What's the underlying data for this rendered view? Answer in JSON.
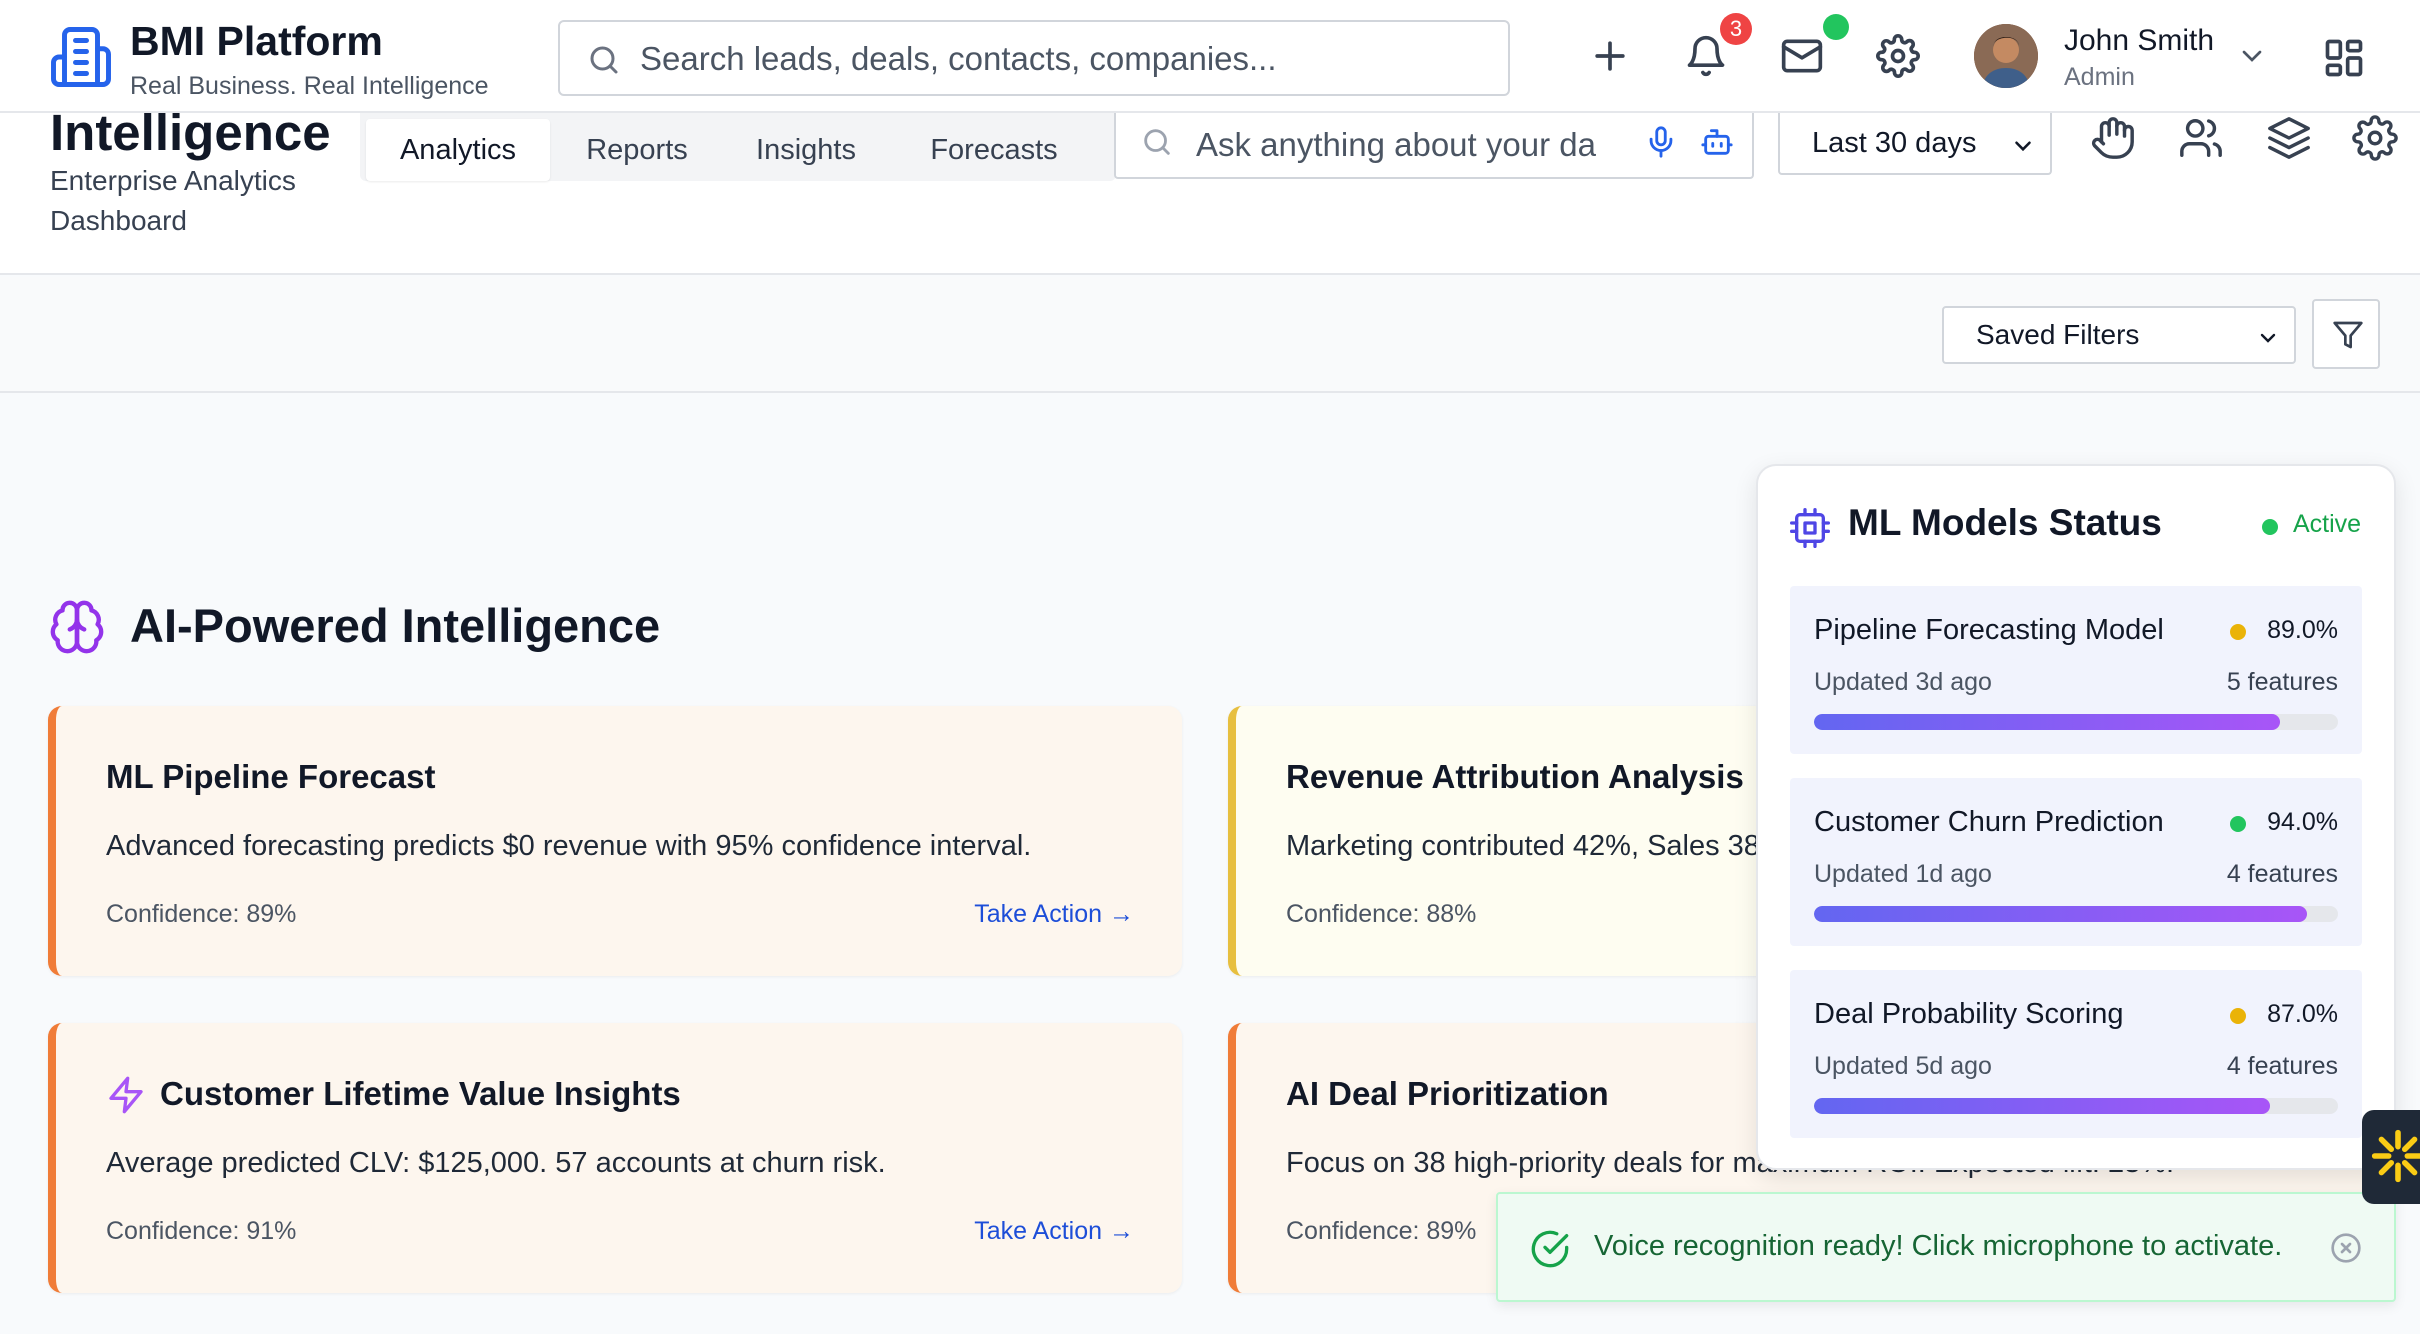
{
  "topbar": {
    "brand_name": "BMI Platform",
    "brand_tagline": "Real Business. Real Intelligence",
    "search_placeholder": "Search leads, deals, contacts, companies...",
    "notification_count": "3",
    "user_name": "John Smith",
    "user_role": "Admin"
  },
  "subheader": {
    "title": "Intelligence",
    "subtitle": "Enterprise Analytics Dashboard",
    "tabs": [
      {
        "label": "Analytics",
        "active": true
      },
      {
        "label": "Reports",
        "active": false
      },
      {
        "label": "Insights",
        "active": false
      },
      {
        "label": "Forecasts",
        "active": false
      }
    ],
    "ai_search_placeholder": "Ask anything about your da",
    "date_range": "Last 30 days"
  },
  "filterbar": {
    "saved_filters_label": "Saved Filters"
  },
  "ai_section": {
    "title": "AI-Powered Intelligence",
    "cards": [
      {
        "title": "ML Pipeline Forecast",
        "description": "Advanced forecasting predicts $0 revenue with 95% confidence interval.",
        "confidence": "Confidence: 89%",
        "action": "Take Action →"
      },
      {
        "title": "Revenue Attribution Analysis",
        "description": "Marketing contributed 42%, Sales 38",
        "confidence": "Confidence: 88%"
      },
      {
        "title": "Customer Lifetime Value Insights",
        "description": "Average predicted CLV: $125,000. 57 accounts at churn risk.",
        "confidence": "Confidence: 91%",
        "action": "Take Action →"
      },
      {
        "title": "AI Deal Prioritization",
        "description": "Focus on 38 high-priority deals for maximum ROI. Expected lift: 23%.",
        "confidence": "Confidence: 89%"
      }
    ]
  },
  "ml_panel": {
    "title": "ML Models Status",
    "status": "Active",
    "models": [
      {
        "name": "Pipeline Forecasting Model",
        "accuracy": "89.0%",
        "updated": "Updated 3d ago",
        "features": "5 features",
        "progress": 0.89,
        "dot_color": "#eab308"
      },
      {
        "name": "Customer Churn Prediction",
        "accuracy": "94.0%",
        "updated": "Updated 1d ago",
        "features": "4 features",
        "progress": 0.94,
        "dot_color": "#22c55e"
      },
      {
        "name": "Deal Probability Scoring",
        "accuracy": "87.0%",
        "updated": "Updated 5d ago",
        "features": "4 features",
        "progress": 0.87,
        "dot_color": "#eab308"
      }
    ]
  },
  "toast": {
    "message": "Voice recognition ready! Click microphone to activate."
  },
  "colors": {
    "brand_blue": "#3b5bdb",
    "accent_purple": "#7c3aed",
    "orange_border": "#f07c38",
    "yellow_border": "#e7bf3f",
    "success_green": "#22c55e",
    "link_blue": "#1d4ed8"
  }
}
